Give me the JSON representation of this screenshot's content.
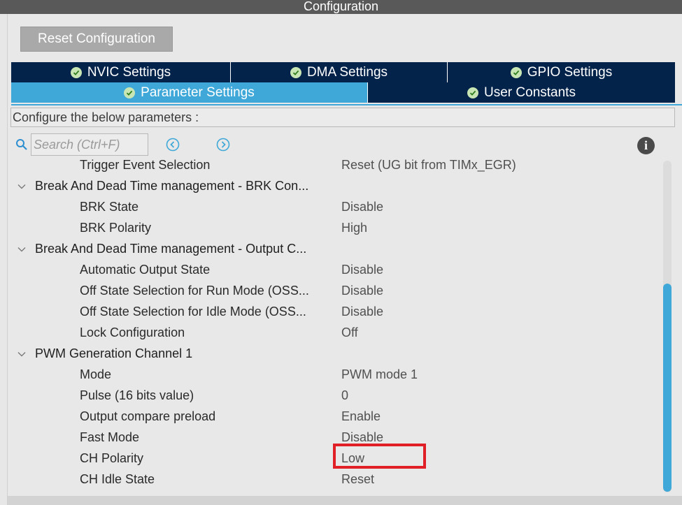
{
  "window": {
    "title": "Configuration"
  },
  "toolbar": {
    "reset_label": "Reset Configuration"
  },
  "tabs_row1": [
    {
      "label": "NVIC Settings"
    },
    {
      "label": "DMA Settings"
    },
    {
      "label": "GPIO Settings"
    }
  ],
  "tabs_row2": [
    {
      "label": "Parameter Settings",
      "active": true
    },
    {
      "label": "User Constants"
    }
  ],
  "configure_label": "Configure the below parameters :",
  "search": {
    "placeholder": "Search (Ctrl+F)"
  },
  "params": {
    "trigger_event": {
      "name": "Trigger Event Selection",
      "value": "Reset (UG bit from TIMx_EGR)"
    },
    "group_brk": "Break And Dead Time management - BRK Con...",
    "brk_state": {
      "name": "BRK State",
      "value": "Disable"
    },
    "brk_polarity": {
      "name": "BRK Polarity",
      "value": "High"
    },
    "group_output": "Break And Dead Time management - Output C...",
    "auto_output": {
      "name": "Automatic Output State",
      "value": "Disable"
    },
    "ossr": {
      "name": "Off State Selection for Run Mode (OSS...",
      "value": "Disable"
    },
    "ossi": {
      "name": "Off State Selection for Idle Mode (OSS...",
      "value": "Disable"
    },
    "lock_config": {
      "name": "Lock Configuration",
      "value": "Off"
    },
    "group_pwm": "PWM Generation Channel 1",
    "mode": {
      "name": "Mode",
      "value": "PWM mode 1"
    },
    "pulse": {
      "name": "Pulse (16 bits value)",
      "value": "0"
    },
    "oc_preload": {
      "name": "Output compare preload",
      "value": "Enable"
    },
    "fast_mode": {
      "name": "Fast Mode",
      "value": "Disable"
    },
    "ch_polarity": {
      "name": "CH Polarity",
      "value": "Low"
    },
    "ch_idle": {
      "name": "CH Idle State",
      "value": "Reset"
    }
  },
  "colors": {
    "tab_dark": "#03234b",
    "tab_active": "#3fa8d8",
    "highlight": "#e01f26"
  }
}
